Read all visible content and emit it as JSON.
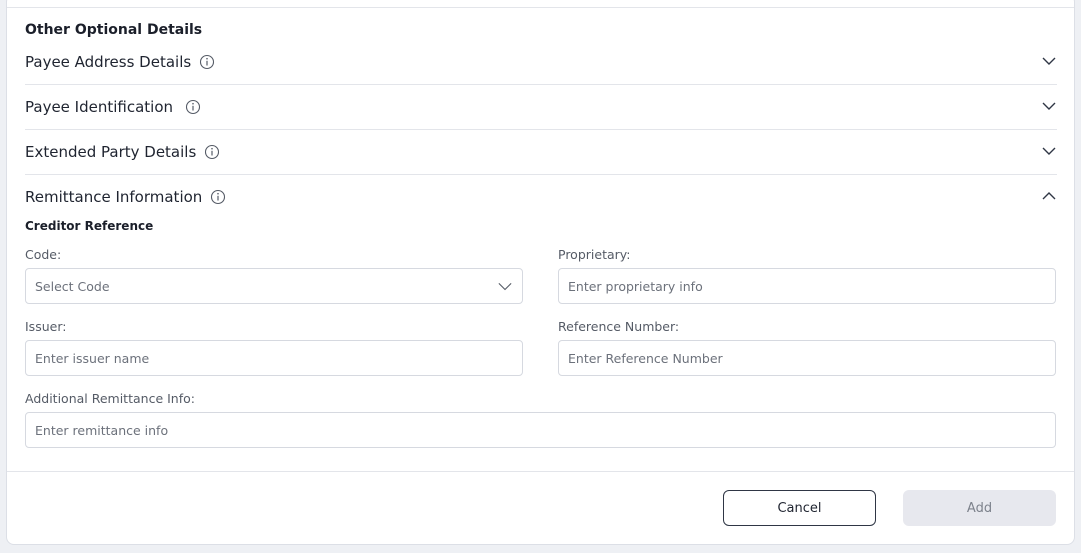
{
  "section": {
    "title": "Other Optional Details"
  },
  "accordions": [
    {
      "label": "Payee Address Details",
      "state": "collapsed",
      "icon": "chevron-down-icon"
    },
    {
      "label": "Payee Identification",
      "state": "collapsed",
      "icon": "chevron-down-icon"
    },
    {
      "label": "Extended Party Details",
      "state": "collapsed",
      "icon": "chevron-down-icon"
    },
    {
      "label": "Remittance Information",
      "state": "expanded",
      "icon": "chevron-up-icon"
    }
  ],
  "remittance": {
    "subheading": "Creditor Reference",
    "code": {
      "label": "Code:",
      "placeholder": "Select Code"
    },
    "proprietary": {
      "label": "Proprietary:",
      "placeholder": "Enter proprietary info"
    },
    "issuer": {
      "label": "Issuer:",
      "placeholder": "Enter issuer name"
    },
    "reference_number": {
      "label": "Reference Number:",
      "placeholder": "Enter Reference Number"
    },
    "additional": {
      "label": "Additional Remittance Info:",
      "placeholder": "Enter remittance info"
    }
  },
  "footer": {
    "cancel_label": "Cancel",
    "add_label": "Add",
    "add_disabled": true
  },
  "colors": {
    "text": "#1f2430",
    "border": "#d6d9e0",
    "divider": "#e3e5ea",
    "disabled_button_bg": "#e7e8ee",
    "page_bg": "#eef0f4"
  }
}
